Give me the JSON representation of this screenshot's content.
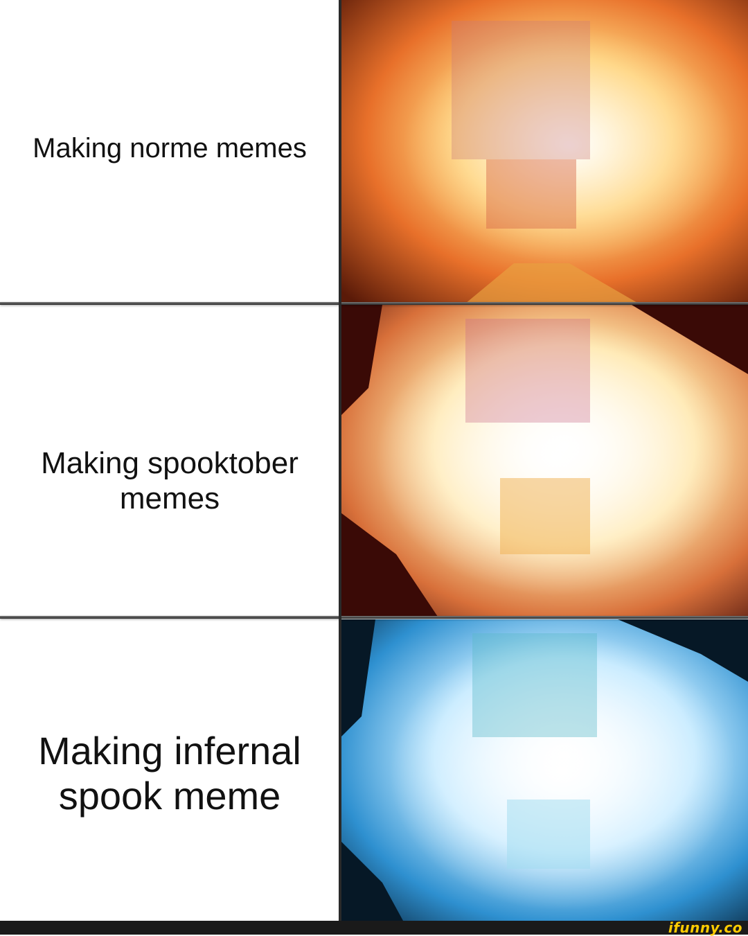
{
  "panels": [
    {
      "caption": "Making norme memes",
      "image": "glowing-face-orange-fire"
    },
    {
      "caption": "Making spooktober memes",
      "image": "glowing-face-white-fire"
    },
    {
      "caption": "Making infernal spook meme",
      "image": "glowing-face-blue-fire"
    }
  ],
  "watermark": {
    "text": "ifunny.co",
    "color": "#ffcc00"
  },
  "colors": {
    "fire_orange": "#ff9a2a",
    "fire_white": "#fff6e6",
    "fire_blue": "#3aa7e0"
  }
}
